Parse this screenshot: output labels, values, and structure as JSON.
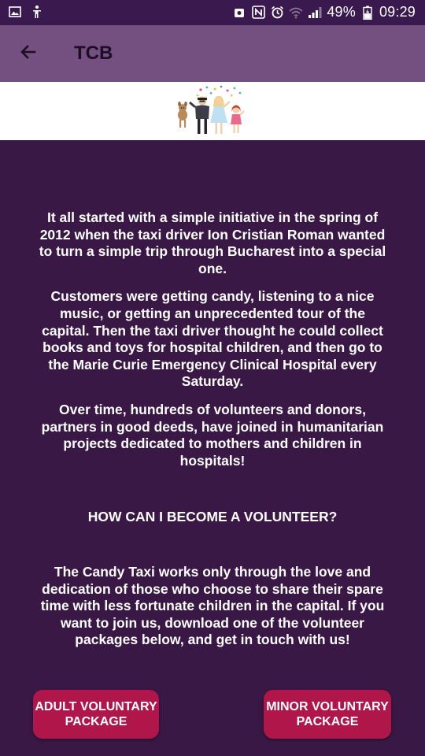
{
  "status_bar": {
    "battery": "49%",
    "time": "09:29",
    "icons_left": [
      "image-icon",
      "accessibility-icon"
    ],
    "icons_right": [
      "screenshot-icon",
      "nfc-icon",
      "alarm-icon",
      "wifi-icon",
      "signal-icon",
      "battery-icon"
    ]
  },
  "app_bar": {
    "title": "TCB",
    "back_icon": "arrow-back-icon"
  },
  "banner": {
    "image": "family-illustration"
  },
  "content": {
    "paragraph_1": "It all started with a simple initiative in the spring of 2012 when the taxi driver Ion Cristian Roman wanted to turn a simple trip through Bucharest into a special one.",
    "paragraph_2": "Customers were getting candy, listening to a nice music, or getting an unprecedented tour of the capital. Then the taxi driver thought he could collect books and toys for hospital children, and then go to the Marie Curie Emergency Clinical Hospital every Saturday.",
    "paragraph_3": "Over time, hundreds of volunteers and donors, partners in good deeds, have joined in humanitarian projects dedicated to mothers and children in hospitals!",
    "heading": "HOW CAN I BECOME A VOLUNTEER?",
    "paragraph_4": "The Candy Taxi works only through the love and dedication of those who choose to share their spare time with less fortunate children in the capital. If you want to join us, download one of the volunteer packages below, and get in touch with us!"
  },
  "buttons": {
    "adult": "ADULT VOLUNTARY PACKAGE",
    "minor": "MINOR VOLUNTARY PACKAGE"
  },
  "colors": {
    "background": "#3a1845",
    "app_bar": "#73507f",
    "button": "#b0164a"
  }
}
